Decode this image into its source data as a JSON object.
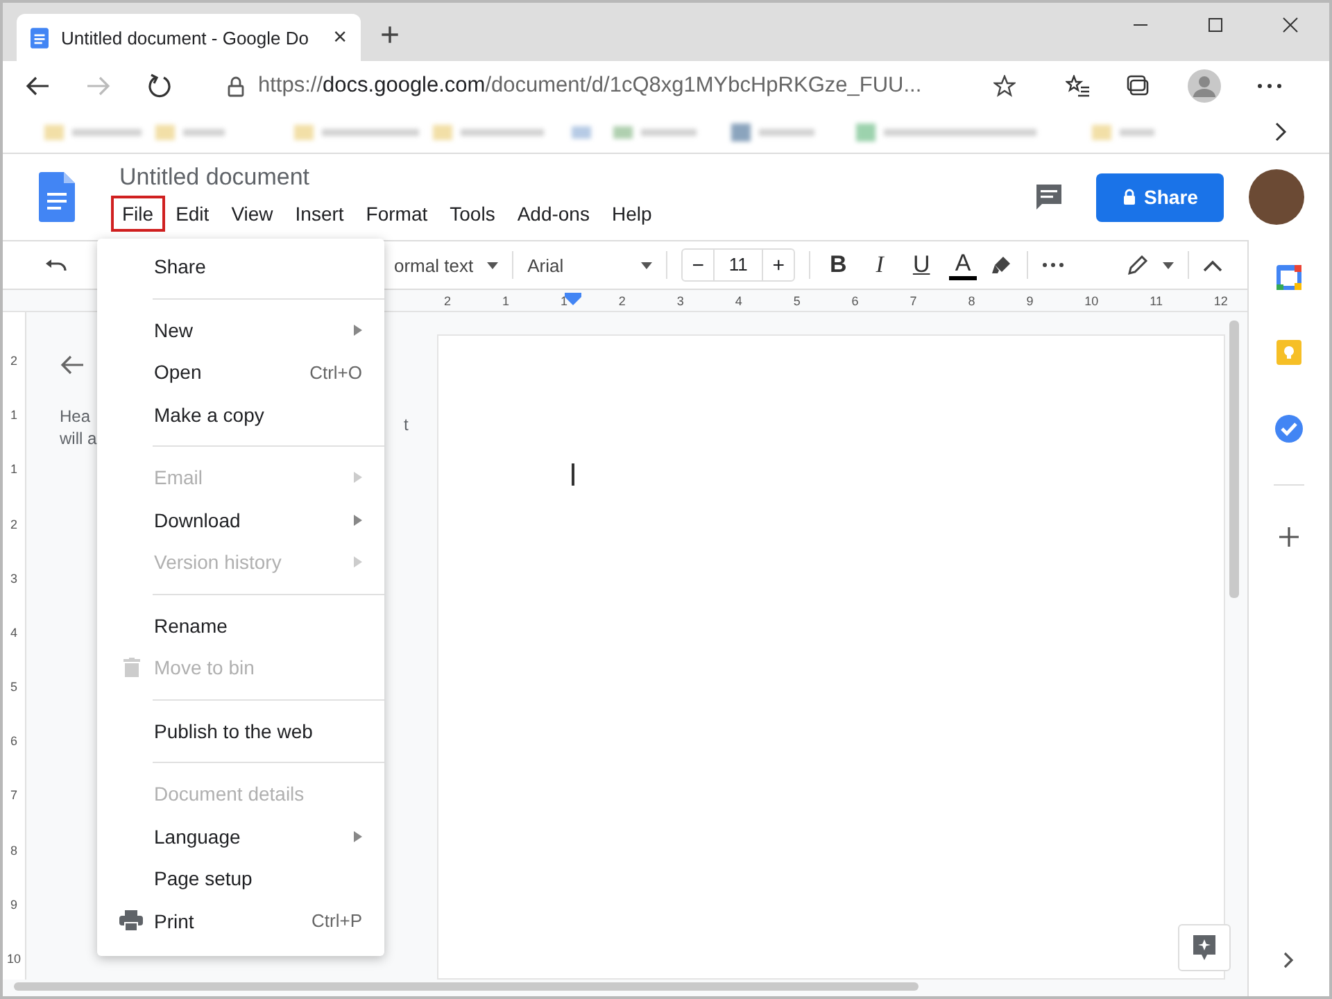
{
  "browser": {
    "tab": {
      "title": "Untitled document - Google Do",
      "close": "×"
    },
    "new_tab": "+",
    "url": {
      "scheme": "https://",
      "host": "docs.google.com",
      "path": "/document/d/1cQ8xg1MYbcHpRKGze_FUU..."
    }
  },
  "docs": {
    "title": "Untitled document",
    "share": "Share",
    "menus": [
      {
        "label": "File",
        "selected": true
      },
      {
        "label": "Edit",
        "selected": false
      },
      {
        "label": "View",
        "selected": false
      },
      {
        "label": "Insert",
        "selected": false
      },
      {
        "label": "Format",
        "selected": false
      },
      {
        "label": "Tools",
        "selected": false
      },
      {
        "label": "Add-ons",
        "selected": false
      },
      {
        "label": "Help",
        "selected": false
      }
    ]
  },
  "toolbar": {
    "style": "ormal text",
    "font": "Arial",
    "size": "11",
    "minus": "−",
    "plus": "+",
    "bold": "B",
    "italic": "I",
    "underline": "U",
    "text_color": "A"
  },
  "ruler": [
    "2",
    "1",
    "1",
    "2",
    "3",
    "4",
    "5",
    "6",
    "7",
    "8",
    "9",
    "10",
    "11",
    "12"
  ],
  "vertical_ruler": [
    "2",
    "1",
    "1",
    "2",
    "3",
    "4",
    "5",
    "6",
    "7",
    "8",
    "9",
    "10"
  ],
  "outline": {
    "line_1": "Hea",
    "line_2": "will a",
    "line_3": "t"
  },
  "file_menu": [
    {
      "kind": "item",
      "label": "Share",
      "disabled": false
    },
    {
      "kind": "divider"
    },
    {
      "kind": "item",
      "label": "New",
      "disabled": false,
      "submenu": true
    },
    {
      "kind": "item",
      "label": "Open",
      "disabled": false,
      "shortcut": "Ctrl+O"
    },
    {
      "kind": "item",
      "label": "Make a copy",
      "disabled": false
    },
    {
      "kind": "divider"
    },
    {
      "kind": "item",
      "label": "Email",
      "disabled": true,
      "submenu": true
    },
    {
      "kind": "item",
      "label": "Download",
      "disabled": false,
      "submenu": true
    },
    {
      "kind": "item",
      "label": "Version history",
      "disabled": true,
      "submenu": true
    },
    {
      "kind": "divider"
    },
    {
      "kind": "item",
      "label": "Rename",
      "disabled": false
    },
    {
      "kind": "trash",
      "label": "Move to bin",
      "disabled": true
    },
    {
      "kind": "divider"
    },
    {
      "kind": "item",
      "label": "Publish to the web",
      "disabled": false
    },
    {
      "kind": "divider"
    },
    {
      "kind": "item",
      "label": "Document details",
      "disabled": true
    },
    {
      "kind": "item",
      "label": "Language",
      "disabled": false,
      "submenu": true
    },
    {
      "kind": "item",
      "label": "Page setup",
      "disabled": false
    },
    {
      "kind": "print",
      "label": "Print",
      "disabled": false,
      "shortcut": "Ctrl+P"
    }
  ]
}
